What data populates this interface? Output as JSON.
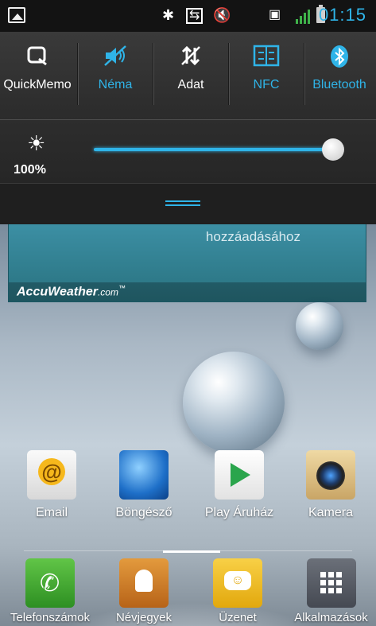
{
  "status_bar": {
    "time": "01:15",
    "icons": [
      "gallery-notification-icon",
      "bluetooth-icon",
      "nfc-icon",
      "mute-icon",
      "sim-icon",
      "signal-icon",
      "battery-icon"
    ],
    "time_color": "#2fb4e8"
  },
  "quick_settings": {
    "items": [
      {
        "label": "QuickMemo",
        "icon": "quickmemo-icon",
        "active": false
      },
      {
        "label": "Néma",
        "icon": "mute-icon",
        "active": true
      },
      {
        "label": "Adat",
        "icon": "data-icon",
        "active": false
      },
      {
        "label": "NFC",
        "icon": "nfc-icon",
        "active": true
      },
      {
        "label": "Bluetooth",
        "icon": "bluetooth-icon",
        "active": true
      }
    ],
    "brightness_label": "100%",
    "brightness_level": 1.0,
    "accent": "#2fb4e8"
  },
  "weather_widget": {
    "text": "hozzáadásához",
    "brand": "AccuWeather",
    "brand_suffix": ".com",
    "brand_tm": "™"
  },
  "apps": [
    {
      "label": "Email",
      "icon": "email-icon"
    },
    {
      "label": "Böngésző",
      "icon": "browser-icon"
    },
    {
      "label": "Play Áruház",
      "icon": "play-store-icon"
    },
    {
      "label": "Kamera",
      "icon": "camera-icon"
    }
  ],
  "dock": [
    {
      "label": "Telefonszámok",
      "icon": "phone-icon"
    },
    {
      "label": "Névjegyek",
      "icon": "contacts-icon"
    },
    {
      "label": "Üzenet",
      "icon": "message-icon"
    },
    {
      "label": "Alkalmazások",
      "icon": "apps-grid-icon"
    }
  ]
}
